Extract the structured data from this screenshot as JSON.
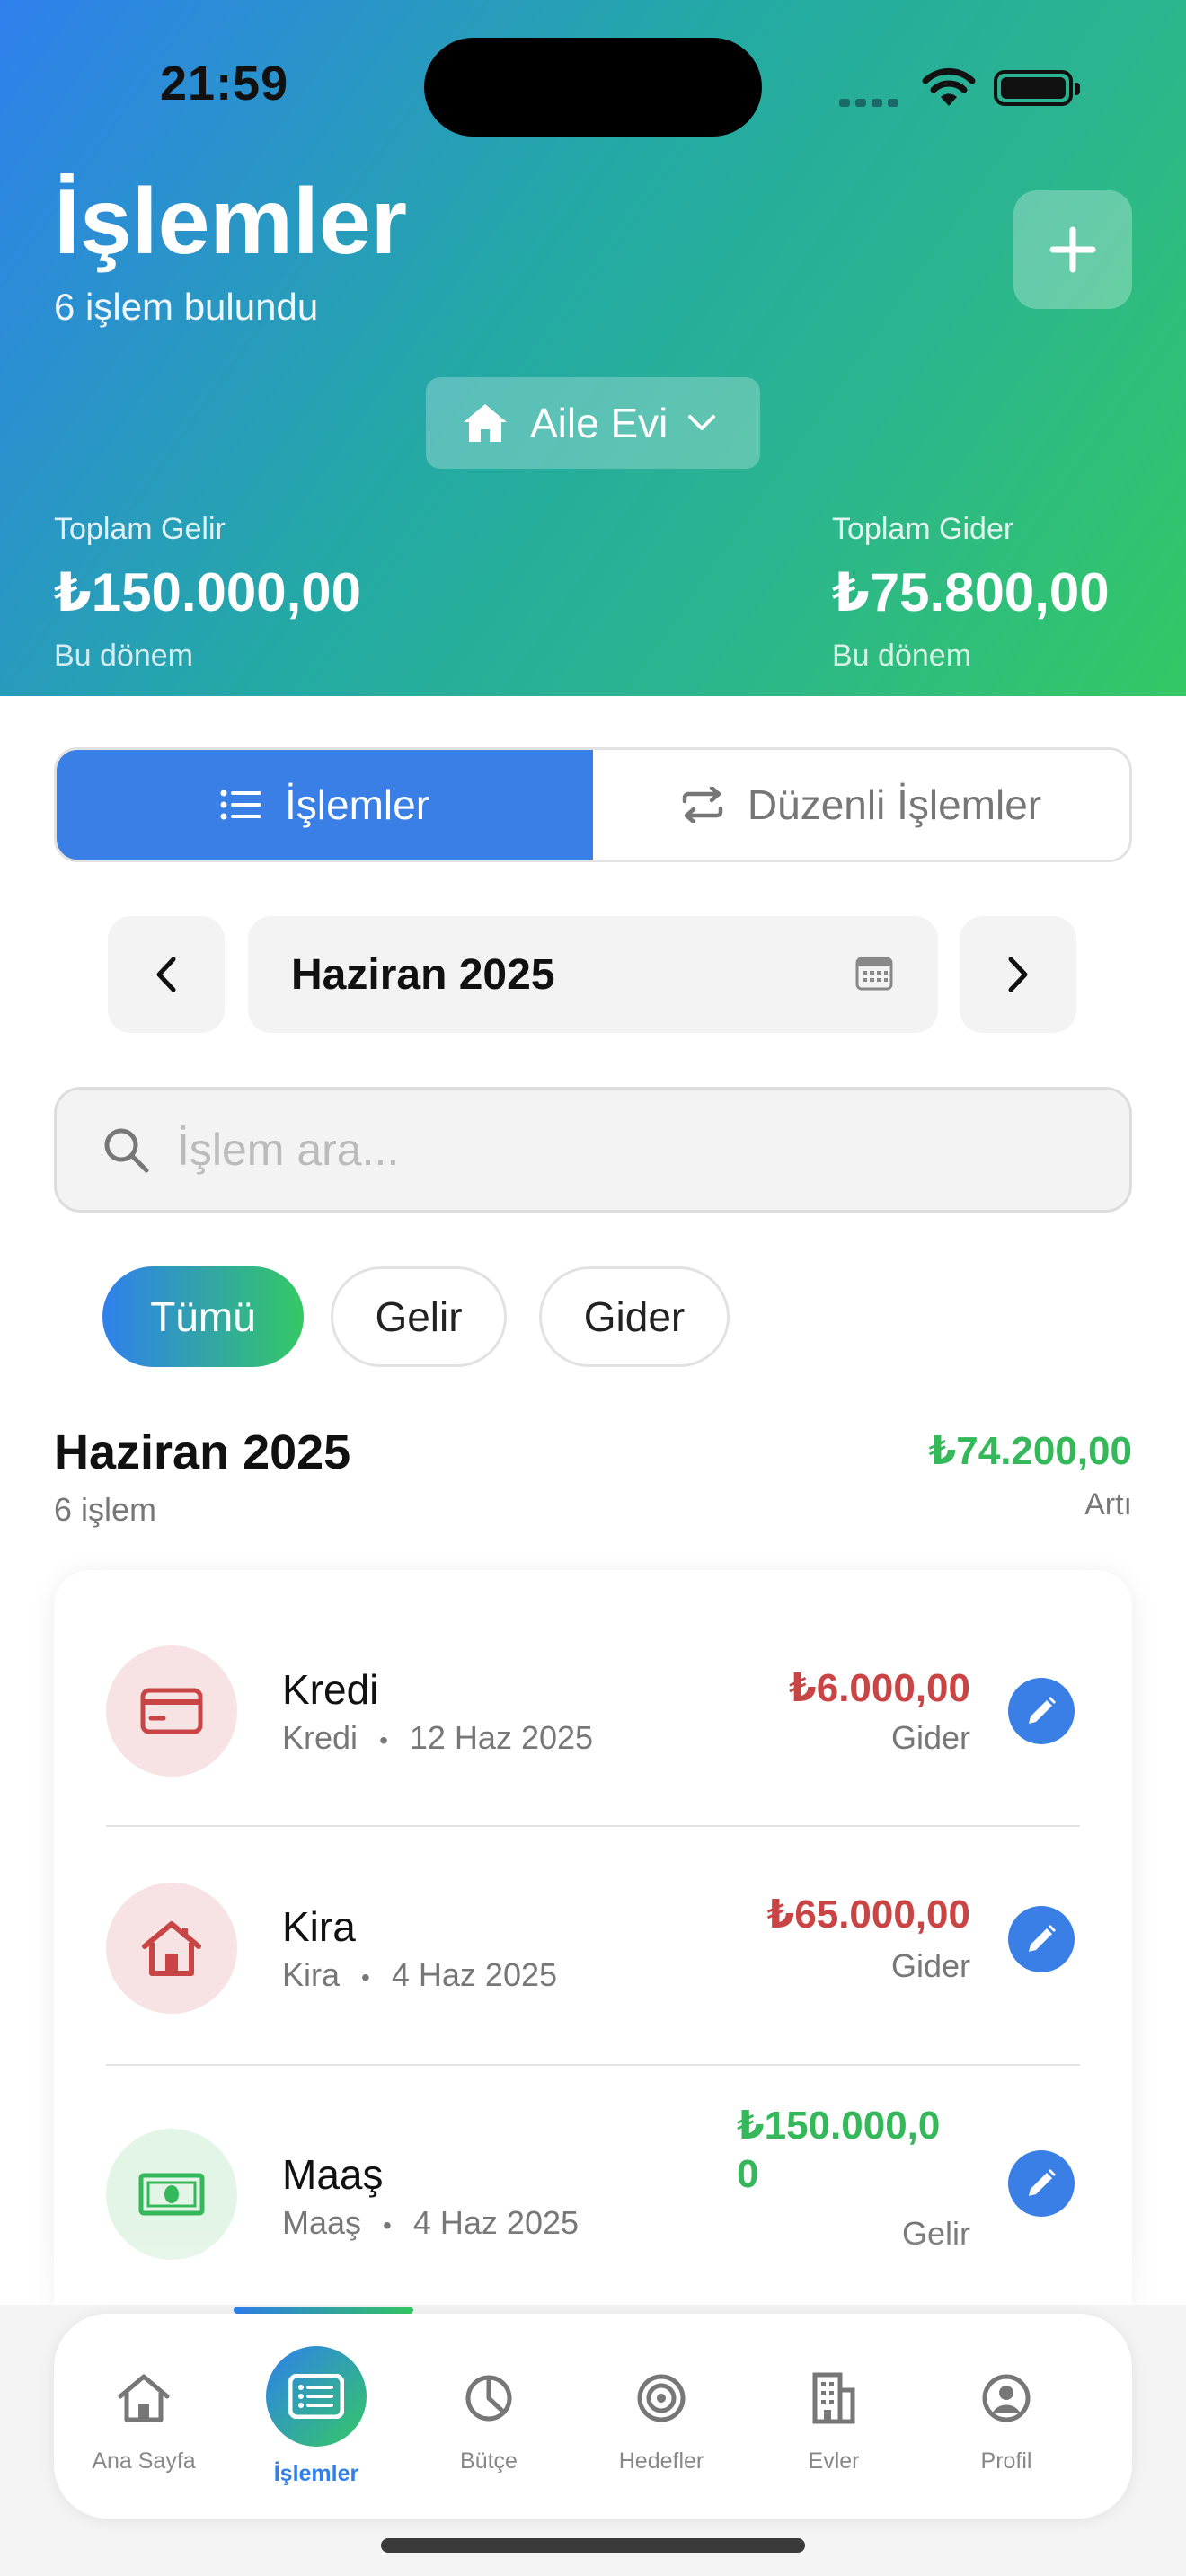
{
  "status_bar": {
    "time": "21:59"
  },
  "header": {
    "title": "İşlemler",
    "subtitle": "6 işlem bulundu",
    "house_selector": "Aile Evi",
    "income": {
      "label": "Toplam Gelir",
      "value": "₺150.000,00",
      "period": "Bu dönem"
    },
    "expense": {
      "label": "Toplam Gider",
      "value": "₺75.800,00",
      "period": "Bu dönem"
    }
  },
  "segments": [
    {
      "label": "İşlemler",
      "icon": "list-icon",
      "active": true
    },
    {
      "label": "Düzenli İşlemler",
      "icon": "repeat-icon",
      "active": false
    }
  ],
  "month_nav": {
    "label": "Haziran 2025"
  },
  "search": {
    "placeholder": "İşlem ara...",
    "value": ""
  },
  "filters": [
    "Tümü",
    "Gelir",
    "Gider"
  ],
  "summary": {
    "title": "Haziran 2025",
    "count": "6 işlem",
    "total": "₺74.200,00",
    "kind": "Artı"
  },
  "transactions": [
    {
      "name": "Kredi",
      "category": "Kredi",
      "date": "12 Haz 2025",
      "amount": "₺6.000,00",
      "kind": "Gider",
      "icon": "credit-card-icon",
      "color": "#c94545"
    },
    {
      "name": "Kira",
      "category": "Kira",
      "date": "4 Haz 2025",
      "amount": "₺65.000,00",
      "kind": "Gider",
      "icon": "house-icon",
      "color": "#c94545"
    },
    {
      "name": "Maaş",
      "category": "Maaş",
      "date": "4 Haz 2025",
      "amount_line1": "₺150.000,0",
      "amount_line2": "0",
      "kind": "Gelir",
      "icon": "banknote-icon",
      "color": "#34b85a"
    }
  ],
  "separator": "•",
  "tabbar": [
    {
      "label": "Ana Sayfa",
      "icon": "home-icon"
    },
    {
      "label": "İşlemler",
      "icon": "list-icon",
      "active": true
    },
    {
      "label": "Bütçe",
      "icon": "pie-chart-icon"
    },
    {
      "label": "Hedefler",
      "icon": "target-icon"
    },
    {
      "label": "Evler",
      "icon": "building-icon"
    },
    {
      "label": "Profil",
      "icon": "profile-icon"
    }
  ],
  "colors": {
    "primary": "#2f80ed",
    "accent_green": "#34c864",
    "expense_red": "#c94545",
    "income_green": "#34b85a"
  }
}
